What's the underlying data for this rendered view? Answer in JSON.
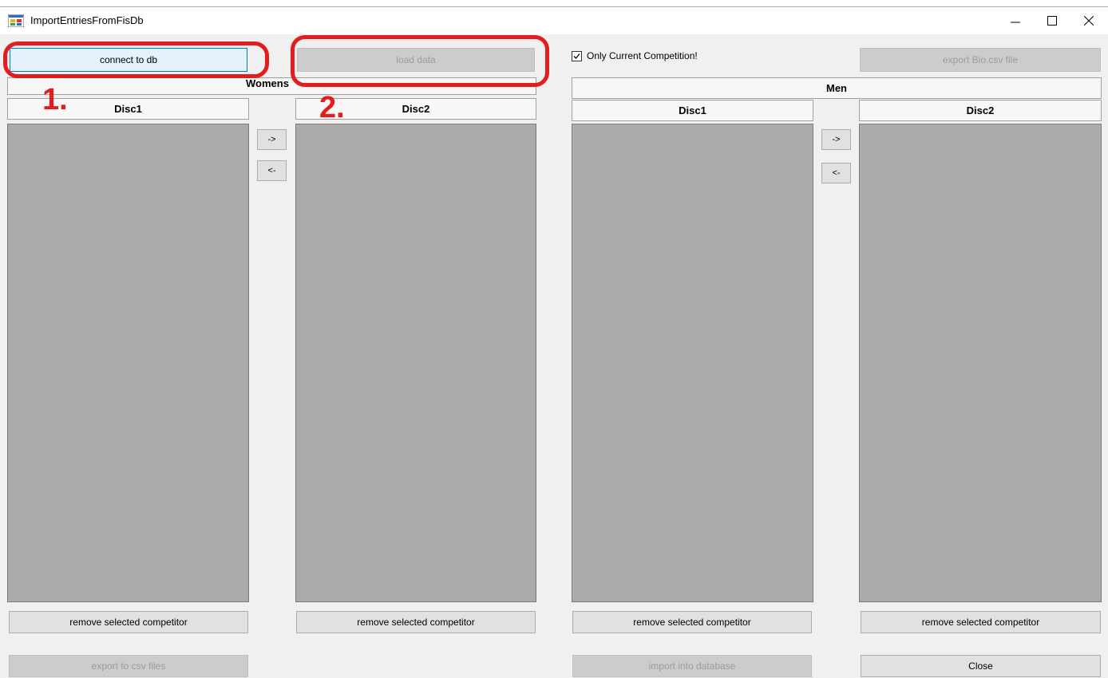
{
  "window": {
    "title": "ImportEntriesFromFisDb"
  },
  "toolbar": {
    "connect_label": "connect to db",
    "load_label": "load data",
    "only_current_label": "Only Current Competition!",
    "only_current_checked": true,
    "export_bio_label": "export Bio.csv file"
  },
  "annotations": {
    "step1": "1.",
    "step2": "2."
  },
  "womens": {
    "title": "Womens",
    "disc1": {
      "header": "Disc1",
      "remove_label": "remove selected competitor"
    },
    "disc2": {
      "header": "Disc2",
      "remove_label": "remove selected competitor"
    },
    "move_right_label": "->",
    "move_left_label": "<-"
  },
  "men": {
    "title": "Men",
    "disc1": {
      "header": "Disc1",
      "remove_label": "remove selected competitor"
    },
    "disc2": {
      "header": "Disc2",
      "remove_label": "remove selected competitor"
    },
    "move_right_label": "->",
    "move_left_label": "<-"
  },
  "footer": {
    "export_csv_label": "export to csv files",
    "import_db_label": "import into database",
    "close_label": "Close"
  }
}
